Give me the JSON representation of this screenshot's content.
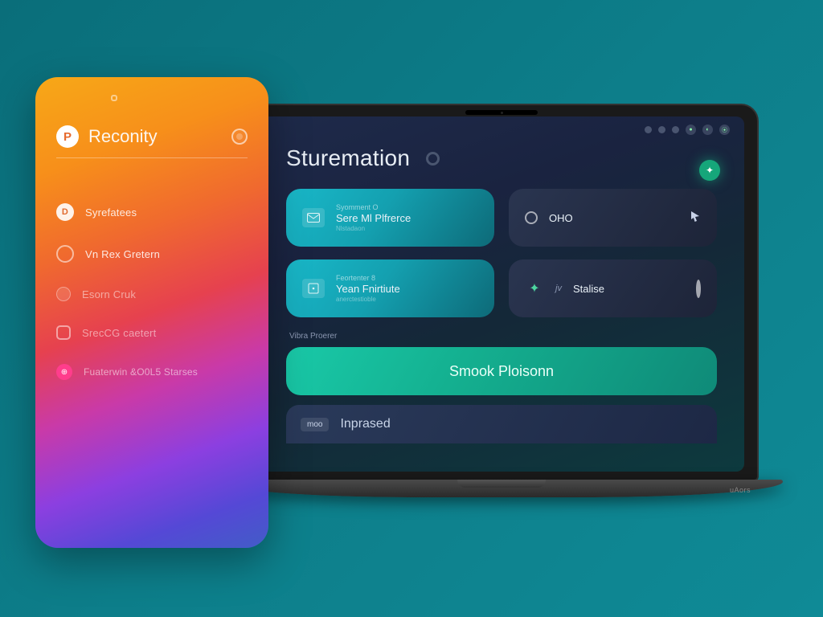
{
  "colors": {
    "teal_bg": "#0d7e8a",
    "accent_green": "#16a67a",
    "card_teal_from": "#19b8c9",
    "card_teal_to": "#0d6a78",
    "banner_from": "#19c9a8"
  },
  "sidebar": {
    "brand_letter": "P",
    "brand_name": "Reconity",
    "items": [
      {
        "label": "Syrefatees",
        "icon": "filled"
      },
      {
        "label": "Vn Rex Gretern",
        "icon": "outline"
      },
      {
        "label": "Esorn Cruk",
        "icon": "dot"
      },
      {
        "label": "SrecCG caetert",
        "icon": "square"
      },
      {
        "label": "Fuaterwin &O0L5 Starses",
        "icon": "pink"
      }
    ]
  },
  "header": {
    "title": "Sturemation"
  },
  "laptop_brand": "uAors",
  "cards": [
    {
      "kicker": "Syomment O",
      "title": "Sere Ml Plfrerce",
      "sub": "Nlstadaon",
      "variant": "teal",
      "icon": "mail-icon"
    },
    {
      "title": "OHO",
      "variant": "dark",
      "icon": "ring-icon",
      "right_icon": "pointer-icon"
    },
    {
      "kicker": "Feortenter 8",
      "title": "Yean Fnirtiute",
      "sub": "anerctestioble",
      "variant": "teal",
      "icon": "doc-icon"
    },
    {
      "title": "Stalise",
      "pre": "jv",
      "variant": "dark",
      "icon": "leaf-icon",
      "right_icon": "ring-large-icon"
    }
  ],
  "section_label": "Vibra Proerer",
  "banner_label": "Smook Ploisonn",
  "bottom": {
    "chip": "moo",
    "label": "Inprased"
  },
  "status_icons": [
    "a1",
    "a2",
    "a3",
    "a4",
    "a5",
    "a6"
  ]
}
